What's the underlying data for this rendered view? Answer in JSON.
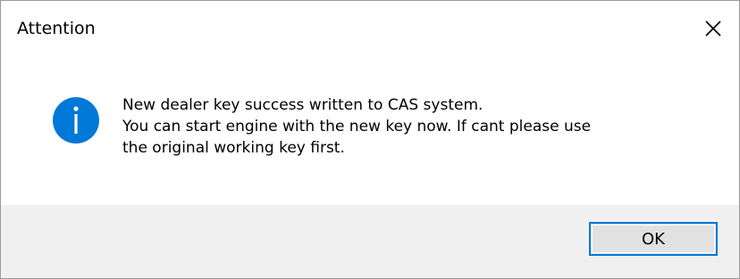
{
  "window": {
    "title": "Attention",
    "close_icon": "close-icon"
  },
  "message": {
    "icon": "info-icon",
    "lines": [
      "New dealer key success written to CAS system.",
      "You can start engine with the new key now. If cant please use",
      "the original working key first."
    ]
  },
  "buttons": {
    "ok_label": "OK"
  },
  "colors": {
    "info_icon_fill": "#0078d7",
    "button_focus_border": "#0078d7",
    "footer_background": "#f0f0f0",
    "button_background": "#e1e1e1"
  }
}
